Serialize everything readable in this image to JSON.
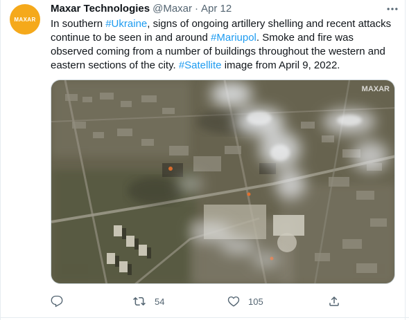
{
  "tweet": {
    "avatar_text": "MAXAR",
    "author_name": "Maxar Technologies",
    "author_handle": "@Maxar",
    "separator": "·",
    "timestamp": "Apr 12",
    "text_parts": [
      {
        "text": "In southern ",
        "link": false
      },
      {
        "text": "#Ukraine",
        "link": true
      },
      {
        "text": ", signs of ongoing artillery shelling and recent attacks continue to be seen in and around ",
        "link": false
      },
      {
        "text": "#Mariupol",
        "link": true
      },
      {
        "text": ". Smoke and fire was observed coming from a number of buildings throughout the western and eastern sections of the city. ",
        "link": false
      },
      {
        "text": "#Satellite",
        "link": true
      },
      {
        "text": " image from April 9, 2022.",
        "link": false
      }
    ],
    "media_watermark": "MAXAR",
    "actions": {
      "reply_icon": "reply-icon",
      "retweet_icon": "retweet-icon",
      "retweet_count": "54",
      "like_icon": "heart-icon",
      "like_count": "105",
      "share_icon": "share-icon"
    },
    "colors": {
      "link": "#1d9bf0",
      "avatar_bg": "#f5a91b",
      "muted": "#536471",
      "text": "#0f1419"
    }
  }
}
